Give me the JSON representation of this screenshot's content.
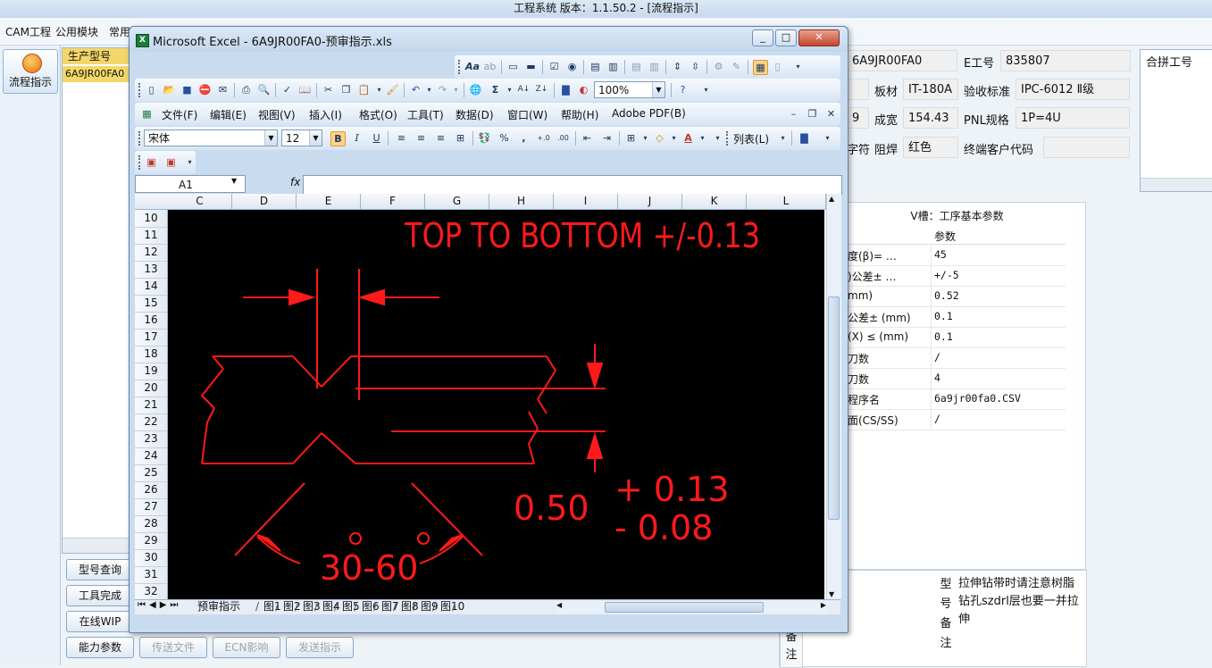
{
  "app": {
    "title": "工程系统   版本：1.1.50.2 - [流程指示]",
    "menu": [
      "CAM工程",
      "公用模块",
      "常用"
    ],
    "flow_button": "流程指示",
    "model_panel": {
      "header": "生产型号",
      "value": "6A9JR00FA0"
    },
    "left_buttons": [
      "型号查询",
      "工具完成",
      "在线WIP",
      "能力参数"
    ],
    "bottom_buttons": [
      "传送文件",
      "ECN影响",
      "发送指示"
    ],
    "info": {
      "part_no_value": "6A9JR00FA0",
      "e_label": "E工号",
      "e_value": "835807",
      "material_label": "板材",
      "material_value": "IT-180A",
      "standard_label": "验收标准",
      "standard_value": "IPC-6012 Ⅱ级",
      "partial_9": "9",
      "width_label": "成宽",
      "width_value": "154.43",
      "pnl_label": "PNL规格",
      "pnl_value": "1P=4U",
      "partial_char": "字符",
      "solder_label": "阻焊",
      "solder_value": "红色",
      "customer_label": "终端客户代码",
      "customer_value": ""
    },
    "combine_header": "合拼工号",
    "params": {
      "title": "V槽：工序基本参数",
      "col_header": "参数",
      "rows": [
        {
          "name": "度(β)= …",
          "value": "45"
        },
        {
          "name": ")公差± …",
          "value": "+/-5"
        },
        {
          "name": "mm)",
          "value": "0.52"
        },
        {
          "name": "公差± (mm)",
          "value": "0.1"
        },
        {
          "name": "(X) ≤ (mm)",
          "value": "0.1"
        },
        {
          "name": "刀数",
          "value": "/"
        },
        {
          "name": "刀数",
          "value": "4"
        },
        {
          "name": "程序名",
          "value": "6a9jr00fa0.CSV"
        },
        {
          "name": "面(CS/SS)",
          "value": "/"
        }
      ]
    },
    "remark": {
      "vert_label": [
        "型",
        "号",
        "备",
        "注"
      ],
      "text": "拉伸钻带时请注意树脂钻孔szdrl层也要一并拉伸",
      "side_label": [
        "备",
        "注"
      ]
    }
  },
  "excel": {
    "title": "Microsoft Excel - 6A9JR00FA0-预审指示.xls",
    "window_buttons": [
      "_",
      "□",
      "✕"
    ],
    "menus": [
      "文件(F)",
      "编辑(E)",
      "视图(V)",
      "插入(I)",
      "格式(O)",
      "工具(T)",
      "数据(D)",
      "窗口(W)",
      "帮助(H)",
      "Adobe PDF(B)"
    ],
    "zoom": "100%",
    "font_name": "宋体",
    "font_size": "12",
    "list_button": "列表(L)",
    "name_box": "A1",
    "fx": "fx",
    "columns": [
      "C",
      "D",
      "E",
      "F",
      "G",
      "H",
      "I",
      "J",
      "K",
      "L"
    ],
    "rows": [
      "10",
      "11",
      "12",
      "13",
      "14",
      "15",
      "16",
      "17",
      "18",
      "19",
      "20",
      "21",
      "22",
      "23",
      "24",
      "25",
      "26",
      "27",
      "28",
      "29",
      "30",
      "31",
      "32"
    ],
    "sheet_tabs": [
      "预审指示",
      "图1",
      "图2",
      "图3",
      "图4",
      "图5",
      "图6",
      "图7",
      "图8",
      "图9",
      "图10"
    ],
    "drawing": {
      "heading": "TOP TO BOTTOM +/-0.13",
      "thickness": "0.50",
      "tol_plus": "+ 0.13",
      "tol_minus": "- 0.08",
      "angle": "30-60",
      "line_color": "#ff1a1a"
    }
  }
}
